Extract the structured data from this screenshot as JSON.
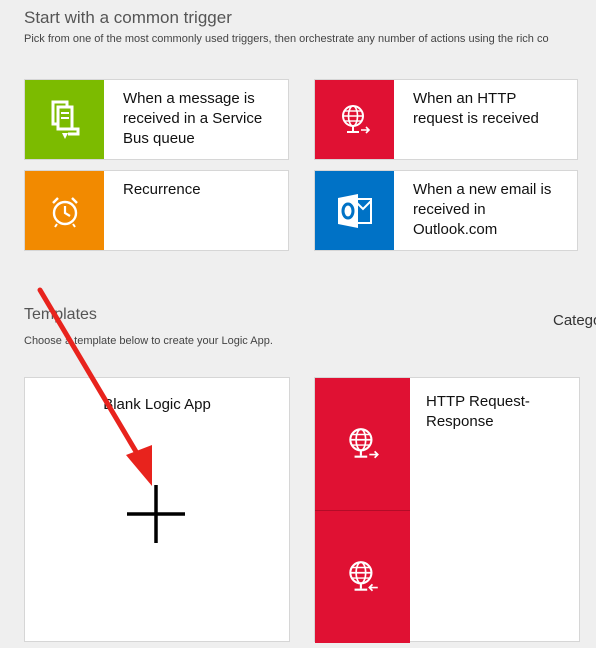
{
  "triggers_section": {
    "title": "Start with a common trigger",
    "subtitle": "Pick from one of the most commonly used triggers, then orchestrate any number of actions using the rich co"
  },
  "triggers": [
    {
      "label_lines": [
        "When a message is",
        "received in a Service",
        "Bus queue"
      ],
      "color": "#7cbb00",
      "icon": "service-bus-icon"
    },
    {
      "label_lines": [
        "When an HTTP",
        "request is received"
      ],
      "color": "#e01133",
      "icon": "http-request-icon"
    },
    {
      "label_lines": [
        "Recurrence"
      ],
      "color": "#f28a00",
      "icon": "alarm-clock-icon"
    },
    {
      "label_lines": [
        "When a new email is",
        "received in",
        "Outlook.com"
      ],
      "color": "#0072c6",
      "icon": "outlook-icon"
    }
  ],
  "templates_section": {
    "title": "Templates",
    "subtitle": "Choose a template below to create your Logic App.",
    "category_label": "Catego"
  },
  "templates": {
    "blank": {
      "label": "Blank Logic App",
      "icon": "plus-icon"
    },
    "http": {
      "label_lines": [
        "HTTP Request-",
        "Response"
      ],
      "color": "#e01133",
      "icons": [
        "http-request-icon",
        "http-response-icon"
      ]
    }
  },
  "annotation": {
    "arrow_color": "#e8231d"
  }
}
